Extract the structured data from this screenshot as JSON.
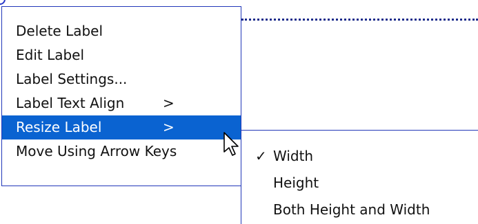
{
  "context_menu": {
    "items": [
      {
        "label": "Delete Label"
      },
      {
        "label": "Edit Label"
      },
      {
        "label": "Label Settings..."
      },
      {
        "label": "Label Text Align",
        "submenu_arrow": ">"
      },
      {
        "label": "Resize Label",
        "submenu_arrow": ">"
      },
      {
        "label": "Move Using Arrow Keys"
      }
    ],
    "highlighted": "Resize Label"
  },
  "resize_submenu": {
    "items": [
      {
        "label": "Width",
        "check": "✓"
      },
      {
        "label": "Height"
      },
      {
        "label": "Both Height and Width"
      }
    ]
  },
  "colors": {
    "highlight": "#0a63d1",
    "border": "#2036b8"
  }
}
